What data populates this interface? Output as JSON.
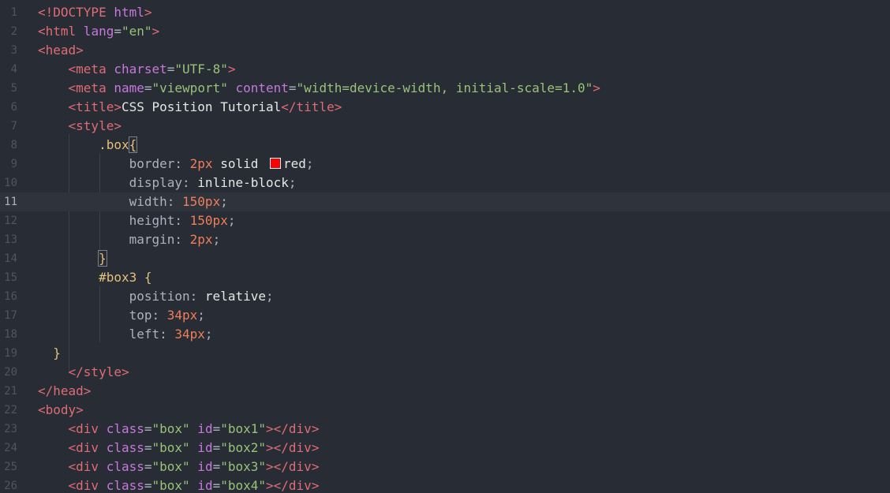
{
  "editor": {
    "active_line": 11,
    "lines": [
      {
        "n": "1",
        "tokens": [
          {
            "t": "<!DOCTYPE",
            "c": "t"
          },
          {
            "t": " html",
            "c": "a"
          },
          {
            "t": ">",
            "c": "t"
          }
        ]
      },
      {
        "n": "2",
        "tokens": [
          {
            "t": "<html",
            "c": "t"
          },
          {
            "t": " lang",
            "c": "a"
          },
          {
            "t": "=",
            "c": "p"
          },
          {
            "t": "\"en\"",
            "c": "s"
          },
          {
            "t": ">",
            "c": "t"
          }
        ]
      },
      {
        "n": "3",
        "tokens": [
          {
            "t": "<head>",
            "c": "t"
          }
        ]
      },
      {
        "n": "4",
        "tokens": [
          {
            "t": "    <meta",
            "c": "t"
          },
          {
            "t": " charset",
            "c": "a"
          },
          {
            "t": "=",
            "c": "p"
          },
          {
            "t": "\"UTF-8\"",
            "c": "s"
          },
          {
            "t": ">",
            "c": "t"
          }
        ]
      },
      {
        "n": "5",
        "tokens": [
          {
            "t": "    <meta",
            "c": "t"
          },
          {
            "t": " name",
            "c": "a"
          },
          {
            "t": "=",
            "c": "p"
          },
          {
            "t": "\"viewport\"",
            "c": "s"
          },
          {
            "t": " content",
            "c": "a"
          },
          {
            "t": "=",
            "c": "p"
          },
          {
            "t": "\"width=device-width, initial-scale=1.0\"",
            "c": "s"
          },
          {
            "t": ">",
            "c": "t"
          }
        ]
      },
      {
        "n": "6",
        "tokens": [
          {
            "t": "    <title>",
            "c": "t"
          },
          {
            "t": "CSS Position Tutorial",
            "c": "w"
          },
          {
            "t": "</title>",
            "c": "t"
          }
        ]
      },
      {
        "n": "7",
        "tokens": [
          {
            "t": "    <style>",
            "c": "t"
          }
        ]
      },
      {
        "n": "8",
        "tokens": [
          {
            "t": "        .box",
            "c": "y"
          },
          {
            "t": "{",
            "c": "y",
            "hl": true
          }
        ]
      },
      {
        "n": "9",
        "tokens": [
          {
            "t": "            border: ",
            "c": "g"
          },
          {
            "t": "2px",
            "c": "n"
          },
          {
            "t": " solid ",
            "c": "w"
          },
          {
            "t": "",
            "c": "swatch",
            "color": "#ff0000"
          },
          {
            "t": "red",
            "c": "w"
          },
          {
            "t": ";",
            "c": "g"
          }
        ]
      },
      {
        "n": "10",
        "tokens": [
          {
            "t": "            display: ",
            "c": "g"
          },
          {
            "t": "inline-block",
            "c": "w"
          },
          {
            "t": ";",
            "c": "g"
          }
        ]
      },
      {
        "n": "11",
        "tokens": [
          {
            "t": "            width: ",
            "c": "g"
          },
          {
            "t": "150px",
            "c": "n"
          },
          {
            "t": ";",
            "c": "g"
          }
        ]
      },
      {
        "n": "12",
        "tokens": [
          {
            "t": "            height: ",
            "c": "g"
          },
          {
            "t": "150px",
            "c": "n"
          },
          {
            "t": ";",
            "c": "g"
          }
        ]
      },
      {
        "n": "13",
        "tokens": [
          {
            "t": "            margin: ",
            "c": "g"
          },
          {
            "t": "2px",
            "c": "n"
          },
          {
            "t": ";",
            "c": "g"
          }
        ]
      },
      {
        "n": "14",
        "tokens": [
          {
            "t": "        ",
            "c": "g"
          },
          {
            "t": "}",
            "c": "y",
            "hl": true
          }
        ]
      },
      {
        "n": "15",
        "tokens": [
          {
            "t": "        #box3",
            "c": "y"
          },
          {
            "t": " {",
            "c": "y"
          }
        ]
      },
      {
        "n": "16",
        "tokens": [
          {
            "t": "            position: ",
            "c": "g"
          },
          {
            "t": "relative",
            "c": "w"
          },
          {
            "t": ";",
            "c": "g"
          }
        ]
      },
      {
        "n": "17",
        "tokens": [
          {
            "t": "            top: ",
            "c": "g"
          },
          {
            "t": "34px",
            "c": "n"
          },
          {
            "t": ";",
            "c": "g"
          }
        ]
      },
      {
        "n": "18",
        "tokens": [
          {
            "t": "            left: ",
            "c": "g"
          },
          {
            "t": "34px",
            "c": "n"
          },
          {
            "t": ";",
            "c": "g"
          }
        ]
      },
      {
        "n": "19",
        "tokens": [
          {
            "t": "  }",
            "c": "y"
          }
        ]
      },
      {
        "n": "20",
        "tokens": [
          {
            "t": "    </style>",
            "c": "t"
          }
        ]
      },
      {
        "n": "21",
        "tokens": [
          {
            "t": "</head>",
            "c": "t"
          }
        ]
      },
      {
        "n": "22",
        "tokens": [
          {
            "t": "<body>",
            "c": "t"
          }
        ]
      },
      {
        "n": "23",
        "tokens": [
          {
            "t": "    <div",
            "c": "t"
          },
          {
            "t": " class",
            "c": "a"
          },
          {
            "t": "=",
            "c": "p"
          },
          {
            "t": "\"box\"",
            "c": "s"
          },
          {
            "t": " id",
            "c": "a"
          },
          {
            "t": "=",
            "c": "p"
          },
          {
            "t": "\"box1\"",
            "c": "s"
          },
          {
            "t": "></div>",
            "c": "t"
          }
        ]
      },
      {
        "n": "24",
        "tokens": [
          {
            "t": "    <div",
            "c": "t"
          },
          {
            "t": " class",
            "c": "a"
          },
          {
            "t": "=",
            "c": "p"
          },
          {
            "t": "\"box\"",
            "c": "s"
          },
          {
            "t": " id",
            "c": "a"
          },
          {
            "t": "=",
            "c": "p"
          },
          {
            "t": "\"box2\"",
            "c": "s"
          },
          {
            "t": "></div>",
            "c": "t"
          }
        ]
      },
      {
        "n": "25",
        "tokens": [
          {
            "t": "    <div",
            "c": "t"
          },
          {
            "t": " class",
            "c": "a"
          },
          {
            "t": "=",
            "c": "p"
          },
          {
            "t": "\"box\"",
            "c": "s"
          },
          {
            "t": " id",
            "c": "a"
          },
          {
            "t": "=",
            "c": "p"
          },
          {
            "t": "\"box3\"",
            "c": "s"
          },
          {
            "t": "></div>",
            "c": "t"
          }
        ]
      },
      {
        "n": "26",
        "tokens": [
          {
            "t": "    <div",
            "c": "t"
          },
          {
            "t": " class",
            "c": "a"
          },
          {
            "t": "=",
            "c": "p"
          },
          {
            "t": "\"box\"",
            "c": "s"
          },
          {
            "t": " id",
            "c": "a"
          },
          {
            "t": "=",
            "c": "p"
          },
          {
            "t": "\"box4\"",
            "c": "s"
          },
          {
            "t": "></div>",
            "c": "t"
          }
        ]
      }
    ]
  }
}
